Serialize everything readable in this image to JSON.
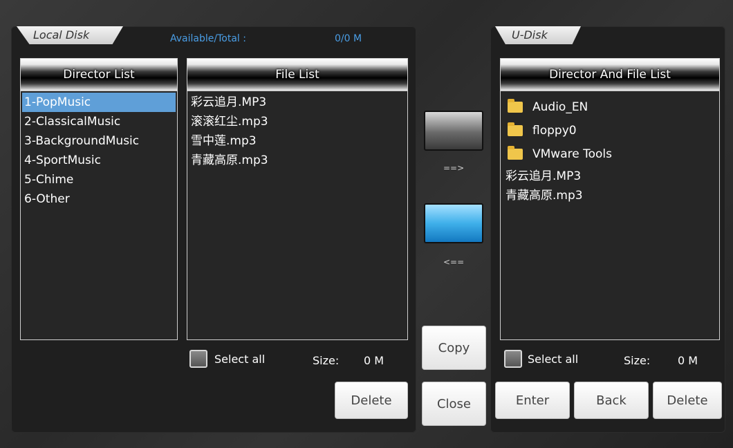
{
  "local": {
    "tab_label": "Local Disk",
    "available_label": "Available/Total :",
    "available_value": "0/0 M",
    "director_list": {
      "header": "Director List",
      "items": [
        "1-PopMusic",
        "2-ClassicalMusic",
        "3-BackgroundMusic",
        "4-SportMusic",
        "5-Chime",
        "6-Other"
      ],
      "selected_index": 0
    },
    "file_list": {
      "header": "File List",
      "items": [
        "彩云追月.MP3",
        "滚滚红尘.mp3",
        "雪中莲.mp3",
        "青藏高原.mp3"
      ]
    },
    "select_all_label": "Select all",
    "size_label": "Size:",
    "size_value": "0 M",
    "delete_label": "Delete"
  },
  "middle": {
    "to_udisk_label": "==>",
    "to_local_label": "<==",
    "copy_label": "Copy",
    "close_label": "Close"
  },
  "udisk": {
    "tab_label": "U-Disk",
    "list": {
      "header": "Director And File List",
      "folders": [
        "Audio_EN",
        "floppy0",
        "VMware Tools"
      ],
      "files": [
        "彩云追月.MP3",
        "青藏高原.mp3"
      ]
    },
    "select_all_label": "Select all",
    "size_label": "Size:",
    "size_value": "0 M",
    "enter_label": "Enter",
    "back_label": "Back",
    "delete_label": "Delete"
  },
  "colors": {
    "accent_blue": "#4a9ee6",
    "selected_row": "#5f9fd8"
  }
}
